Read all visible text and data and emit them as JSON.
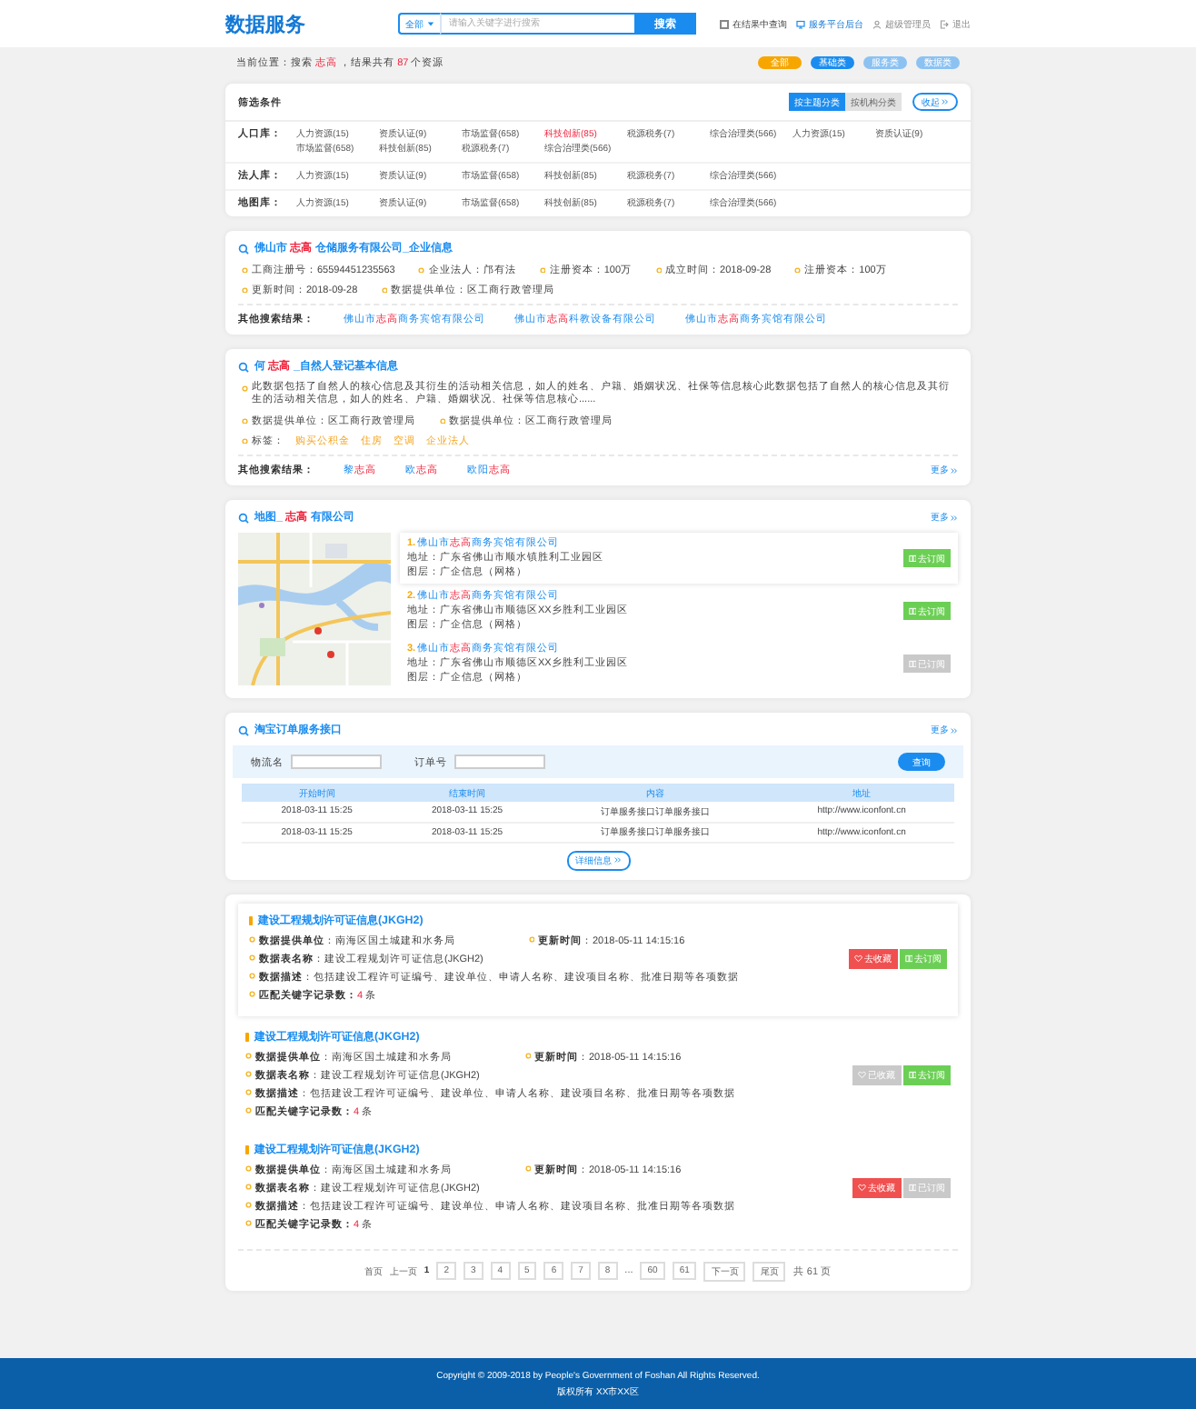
{
  "header": {
    "logo": "数据服务",
    "search": {
      "scope": "全部",
      "placeholder": "请输入关键字进行搜索",
      "button": "搜索"
    },
    "in_results": {
      "label": "在结果中查询",
      "checked": false
    },
    "links": [
      {
        "kind": "admin",
        "label": "服务平台后台"
      },
      {
        "kind": "user",
        "label": "超级管理员"
      },
      {
        "kind": "logout",
        "label": "退出"
      }
    ]
  },
  "breadcrumb": [
    {
      "text": "当前位置：搜索 "
    },
    {
      "text": "志高",
      "highlight": true
    },
    {
      "text": " ，结果共有 "
    },
    {
      "text": "87",
      "highlight": true
    },
    {
      "text": " 个资源"
    }
  ],
  "categories": [
    {
      "label": "全部",
      "color": "#f7a600"
    },
    {
      "label": "基础类",
      "color": "#1a8cf0"
    },
    {
      "label": "服务类",
      "color": "#8cc2f2"
    },
    {
      "label": "数据类",
      "color": "#8cc2f2"
    }
  ],
  "filter": {
    "title": "筛选条件",
    "views": [
      {
        "label": "按主题分类",
        "selected": true
      },
      {
        "label": "按机构分类",
        "selected": false
      }
    ],
    "collapse": "收起",
    "rows": [
      {
        "label": "人口库：",
        "items": [
          {
            "label": "人力资源(15)",
            "selected": false
          },
          {
            "label": "资质认证(9)",
            "selected": false
          },
          {
            "label": "市场监督(658)",
            "selected": false
          },
          {
            "label": "科技创新(85)",
            "selected": true
          },
          {
            "label": "税源税务(7)",
            "selected": false
          },
          {
            "label": "综合治理类(566)",
            "selected": false
          },
          {
            "label": "人力资源(15)",
            "selected": false
          },
          {
            "label": "资质认证(9)",
            "selected": false
          },
          {
            "label": "市场监督(658)",
            "selected": false
          },
          {
            "label": "科技创新(85)",
            "selected": false
          },
          {
            "label": "税源税务(7)",
            "selected": false
          },
          {
            "label": "综合治理类(566)",
            "selected": false
          }
        ]
      },
      {
        "label": "法人库：",
        "items": [
          {
            "label": "人力资源(15)",
            "selected": false
          },
          {
            "label": "资质认证(9)",
            "selected": false
          },
          {
            "label": "市场监督(658)",
            "selected": false
          },
          {
            "label": "科技创新(85)",
            "selected": false
          },
          {
            "label": "税源税务(7)",
            "selected": false
          },
          {
            "label": "综合治理类(566)",
            "selected": false
          }
        ]
      },
      {
        "label": "地图库：",
        "items": [
          {
            "label": "人力资源(15)",
            "selected": false
          },
          {
            "label": "资质认证(9)",
            "selected": false
          },
          {
            "label": "市场监督(658)",
            "selected": false
          },
          {
            "label": "科技创新(85)",
            "selected": false
          },
          {
            "label": "税源税务(7)",
            "selected": false
          },
          {
            "label": "综合治理类(566)",
            "selected": false
          }
        ]
      }
    ]
  },
  "company": {
    "title": [
      {
        "text": "佛山市 "
      },
      {
        "text": "志高",
        "highlight": true
      },
      {
        "text": " 仓储服务有限公司_企业信息"
      }
    ],
    "fields": [
      "工商注册号：65594451235563",
      "企业法人：邝有法",
      "注册资本：100万",
      "成立时间：2018-09-28",
      "注册资本：100万",
      "更新时间：2018-09-28",
      "数据提供单位：区工商行政管理局"
    ],
    "others_label": "其他搜索结果：",
    "others": [
      [
        {
          "text": "佛山市"
        },
        {
          "text": "志高",
          "highlight": true
        },
        {
          "text": "商务宾馆有限公司"
        }
      ],
      [
        {
          "text": "佛山市"
        },
        {
          "text": "志高",
          "highlight": true
        },
        {
          "text": "科教设备有限公司"
        }
      ],
      [
        {
          "text": "佛山市"
        },
        {
          "text": "志高",
          "highlight": true
        },
        {
          "text": "商务宾馆有限公司"
        }
      ]
    ]
  },
  "person": {
    "title": [
      {
        "text": "何 "
      },
      {
        "text": "志高",
        "highlight": true
      },
      {
        "text": " _自然人登记基本信息"
      }
    ],
    "description": "此数据包括了自然人的核心信息及其衍生的活动相关信息，如人的姓名、户籍、婚姻状况、社保等信息核心此数据包括了自然人的核心信息及其衍生的活动相关信息，如人的姓名、户籍、婚姻状况、社保等信息核心......",
    "fields": [
      "数据提供单位：区工商行政管理局",
      "数据提供单位：区工商行政管理局"
    ],
    "tags_label": "标签：",
    "tags": [
      "购买公积金",
      "住房",
      "空调",
      "企业法人"
    ],
    "others_label": "其他搜索结果：",
    "others": [
      [
        {
          "text": "黎"
        },
        {
          "text": "志高",
          "highlight": true
        }
      ],
      [
        {
          "text": "欧"
        },
        {
          "text": "志高",
          "highlight": true
        }
      ],
      [
        {
          "text": "欧阳"
        },
        {
          "text": "志高",
          "highlight": true
        }
      ]
    ],
    "more": "更多"
  },
  "map": {
    "title": [
      {
        "text": "地图_ "
      },
      {
        "text": "志高",
        "highlight": true
      },
      {
        "text": " 有限公司"
      }
    ],
    "more": "更多",
    "places": [
      {
        "number": "1.",
        "name": [
          {
            "text": "佛山市"
          },
          {
            "text": "志高",
            "highlight": true
          },
          {
            "text": "商务宾馆有限公司"
          }
        ],
        "address": "地址：广东省佛山市顺水镇胜利工业园区",
        "layer": "图层：广企信息（网格）",
        "selected": true,
        "action": "去订阅",
        "subscribed": false
      },
      {
        "number": "2.",
        "name": [
          {
            "text": "佛山市"
          },
          {
            "text": "志高",
            "highlight": true
          },
          {
            "text": "商务宾馆有限公司"
          }
        ],
        "address": "地址：广东省佛山市顺德区XX乡胜利工业园区",
        "layer": "图层：广企信息（网格）",
        "selected": false,
        "action": "去订阅",
        "subscribed": false
      },
      {
        "number": "3.",
        "name": [
          {
            "text": "佛山市"
          },
          {
            "text": "志高",
            "highlight": true
          },
          {
            "text": "商务宾馆有限公司"
          }
        ],
        "address": "地址：广东省佛山市顺德区XX乡胜利工业园区",
        "layer": "图层：广企信息（网格）",
        "selected": false,
        "action": "已订阅",
        "subscribed": true
      }
    ]
  },
  "orders": {
    "title": "淘宝订单服务接口",
    "more": "更多",
    "form": [
      {
        "label": "物流名"
      },
      {
        "label": "订单号"
      }
    ],
    "query": "查询",
    "columns": [
      "开始时间",
      "结束时间",
      "内容",
      "地址"
    ],
    "rows": [
      [
        "2018-03-11 15:25",
        "2018-03-11 15:25",
        "订单服务接口订单服务接口",
        "http://www.iconfont.cn"
      ],
      [
        "2018-03-11 15:25",
        "2018-03-11 15:25",
        "订单服务接口订单服务接口",
        "http://www.iconfont.cn"
      ]
    ],
    "details": "详细信息"
  },
  "datasets": {
    "items": [
      {
        "title": "建设工程规划许可证信息(JKGH2)",
        "selected": true,
        "fields": [
          [
            "**数据提供单位**：南海区国土城建和水务局",
            "**更新时间**：2018-05-11 14:15:16"
          ],
          [
            "**数据表名称**：建设工程规划许可证信息(JKGH2)"
          ],
          [
            "**数据描述**：包括建设工程许可证编号、建设单位、申请人名称、建设项目名称、批准日期等各项数据"
          ]
        ],
        "match": {
          "label": "匹配关键字记录数：",
          "count": "4",
          "unit": "条"
        },
        "favorite": {
          "label": "去收藏",
          "done": false
        },
        "subscribe": {
          "label": "去订阅",
          "done": false
        }
      },
      {
        "title": "建设工程规划许可证信息(JKGH2)",
        "selected": false,
        "fields": [
          [
            "**数据提供单位**：南海区国土城建和水务局",
            "**更新时间**：2018-05-11 14:15:16"
          ],
          [
            "**数据表名称**：建设工程规划许可证信息(JKGH2)"
          ],
          [
            "**数据描述**：包括建设工程许可证编号、建设单位、申请人名称、建设项目名称、批准日期等各项数据"
          ]
        ],
        "match": {
          "label": "匹配关键字记录数：",
          "count": "4",
          "unit": "条"
        },
        "favorite": {
          "label": "已收藏",
          "done": true
        },
        "subscribe": {
          "label": "去订阅",
          "done": false
        }
      },
      {
        "title": "建设工程规划许可证信息(JKGH2)",
        "selected": false,
        "fields": [
          [
            "**数据提供单位**：南海区国土城建和水务局",
            "**更新时间**：2018-05-11 14:15:16"
          ],
          [
            "**数据表名称**：建设工程规划许可证信息(JKGH2)"
          ],
          [
            "**数据描述**：包括建设工程许可证编号、建设单位、申请人名称、建设项目名称、批准日期等各项数据"
          ]
        ],
        "match": {
          "label": "匹配关键字记录数：",
          "count": "4",
          "unit": "条"
        },
        "favorite": {
          "label": "去收藏",
          "done": false
        },
        "subscribe": {
          "label": "已订阅",
          "done": true
        }
      }
    ],
    "pagination": {
      "first": "首页",
      "prev": "上一页",
      "pages": [
        {
          "kind": "page",
          "label": "1",
          "selected": true
        },
        {
          "kind": "page",
          "label": "2",
          "selected": false
        },
        {
          "kind": "page",
          "label": "3",
          "selected": false
        },
        {
          "kind": "page",
          "label": "4",
          "selected": false
        },
        {
          "kind": "page",
          "label": "5",
          "selected": false
        },
        {
          "kind": "page",
          "label": "6",
          "selected": false
        },
        {
          "kind": "page",
          "label": "7",
          "selected": false
        },
        {
          "kind": "page",
          "label": "8",
          "selected": false
        },
        {
          "kind": "gap",
          "label": "..."
        },
        {
          "kind": "page",
          "label": "60",
          "selected": false
        },
        {
          "kind": "page",
          "label": "61",
          "selected": false
        }
      ],
      "next": "下一页",
      "last": "尾页",
      "total": "共 61 页"
    }
  },
  "footer": [
    "Copyright © 2009-2018 by People's Government of Foshan All Rights Reserved.",
    "版权所有 XX市XX区"
  ]
}
